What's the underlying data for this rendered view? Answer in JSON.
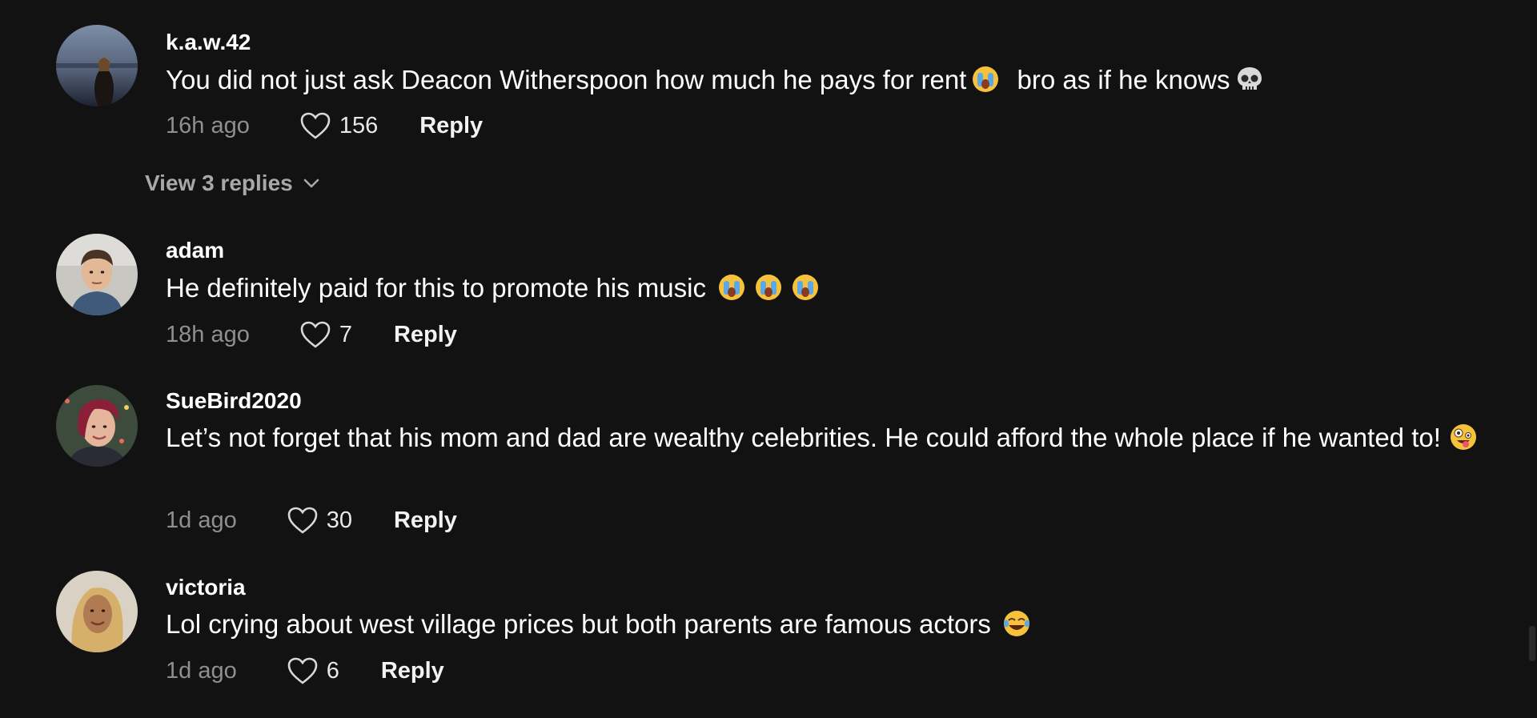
{
  "comments": [
    {
      "username": "k.a.w.42",
      "text": "You did not just ask Deacon Witherspoon how much he pays for rent",
      "text_after": "bro as if he knows",
      "time": "16h ago",
      "likes": "156",
      "reply_label": "Reply",
      "view_replies": "View 3 replies"
    },
    {
      "username": "adam",
      "text": "He definitely paid for this to promote his music",
      "time": "18h ago",
      "likes": "7",
      "reply_label": "Reply"
    },
    {
      "username": "SueBird2020",
      "text": "Let’s not forget that his mom and dad are wealthy celebrities. He could afford the whole place if he wanted to!",
      "time": "1d ago",
      "likes": "30",
      "reply_label": "Reply"
    },
    {
      "username": "victoria",
      "text": "Lol crying about west village prices but both parents are famous actors",
      "time": "1d ago",
      "likes": "6",
      "reply_label": "Reply"
    }
  ],
  "colors": {
    "background": "#121212",
    "text_primary": "#ffffff",
    "text_muted": "#8f8f8f"
  },
  "icons": [
    "heart-outline-icon",
    "chevron-down-icon",
    "loudly-crying-face-emoji",
    "skull-emoji",
    "zany-face-emoji",
    "tears-of-joy-emoji"
  ]
}
